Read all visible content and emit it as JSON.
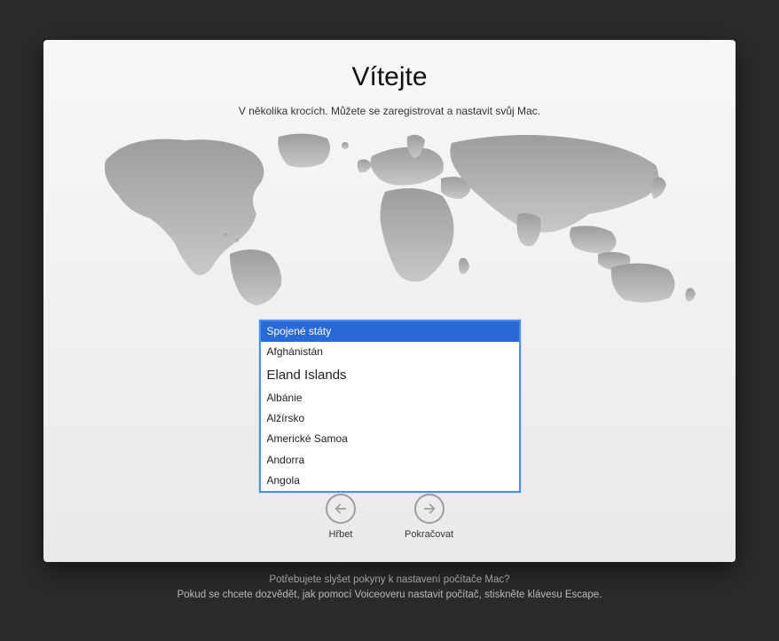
{
  "welcome": {
    "title": "Vítejte",
    "subtitle": "V několika krocích. Můžete se zaregistrovat a nastavit svůj Mac."
  },
  "country_list": {
    "selected_index": 0,
    "items": [
      "Spojené státy",
      "Afghánistán",
      "Eland Islands",
      "Albánie",
      "Alžírsko",
      "Americké Samoa",
      "Andorra",
      "Angola"
    ]
  },
  "nav": {
    "back_label": "Hřbet",
    "continue_label": "Pokračovat"
  },
  "footer": {
    "line1": "Potřebujete slyšet pokyny k nastavení počítače Mac?",
    "line2": "Pokud se chcete dozvědět, jak pomocí Voiceoveru nastavit počítač, stiskněte klávesu Escape."
  }
}
